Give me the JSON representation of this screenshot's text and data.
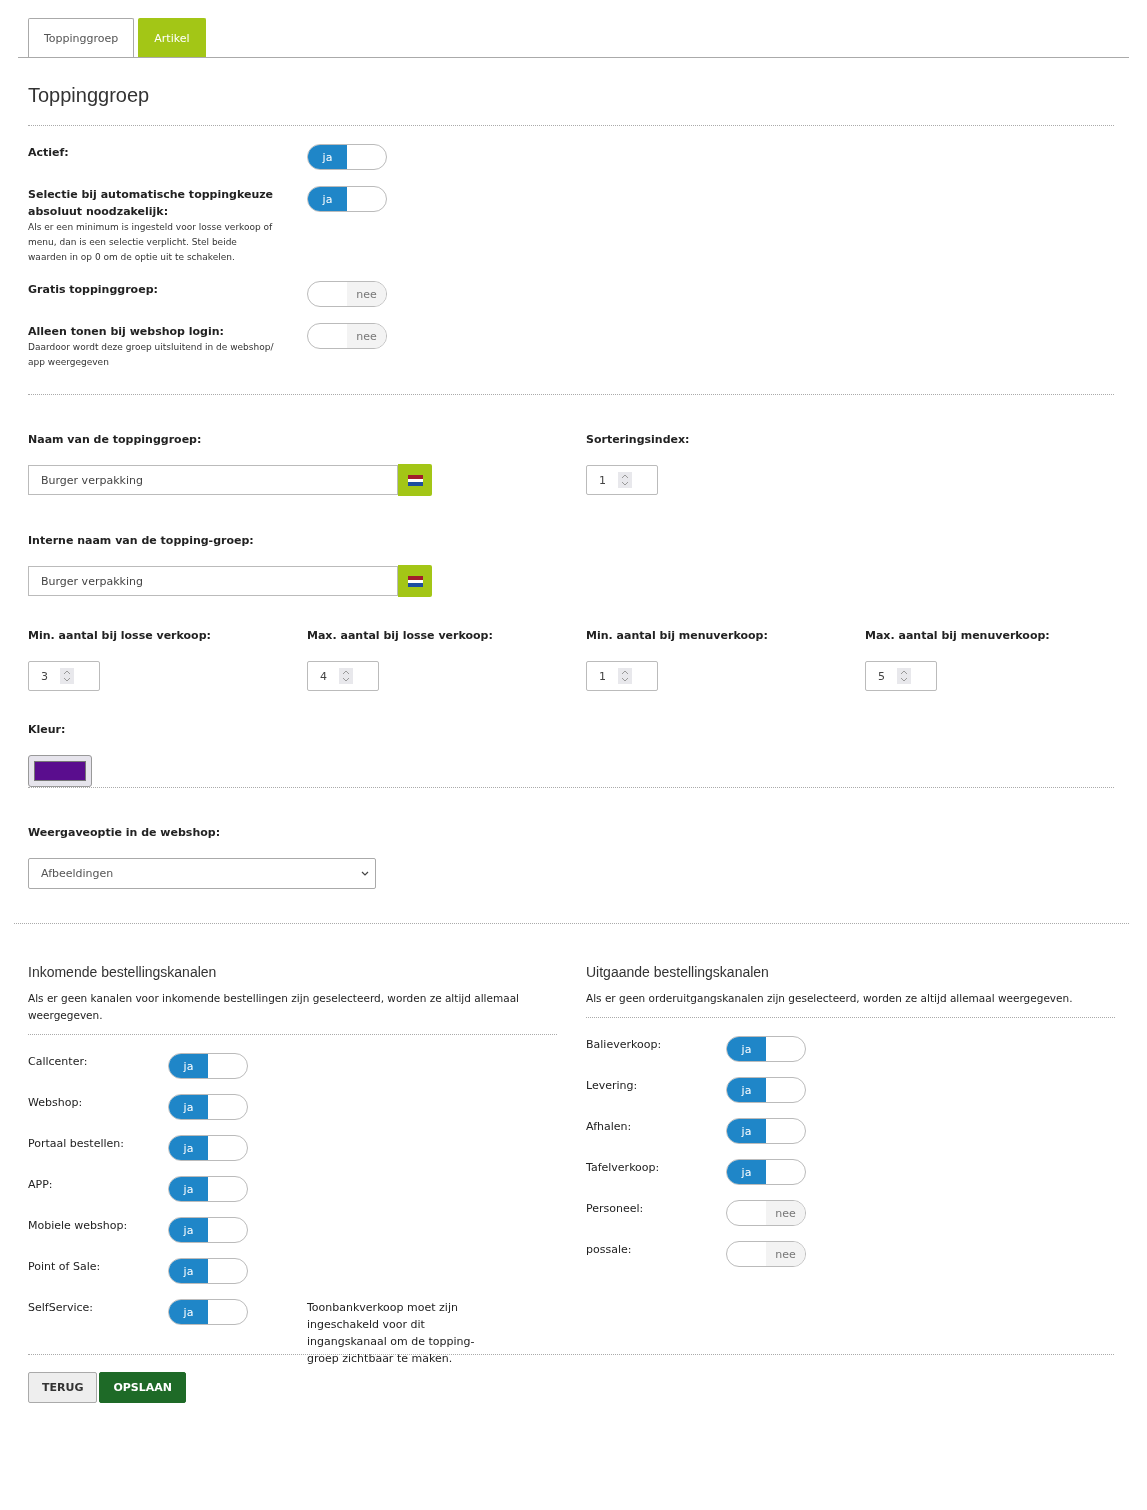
{
  "tabs": [
    {
      "label": "Toppinggroep",
      "selected": true
    },
    {
      "label": "Artikel",
      "selected": false
    }
  ],
  "heading": "Toppinggroep",
  "settings": [
    {
      "label": "Actief:",
      "toggle": {
        "on": true,
        "text": "ja"
      }
    },
    {
      "label": "Selectie bij automatische toppingkeuze absoluut noodzakelijk:",
      "description": "Als er een minimum is ingesteld voor losse verkoop of menu, dan is een selectie verplicht. Stel beide waarden in op 0 om de optie uit te schakelen.",
      "toggle": {
        "on": true,
        "text": "ja"
      }
    },
    {
      "label": "Gratis toppinggroep:",
      "toggle": {
        "on": false,
        "text": "nee"
      }
    },
    {
      "label": "Alleen tonen bij webshop login:",
      "description": "Daardoor wordt deze groep uitsluitend in de webshop/ app weergegeven",
      "toggle": {
        "on": false,
        "text": "nee"
      }
    }
  ],
  "name_field": {
    "label": "Naam van de toppinggroep:",
    "value": "Burger verpakking"
  },
  "sort_index": {
    "label": "Sorteringsindex:",
    "value": "1"
  },
  "internal_name_field": {
    "label": "Interne naam van de topping-groep:",
    "value": "Burger verpakking"
  },
  "quantities": [
    {
      "label": "Min. aantal bij losse verkoop:",
      "value": "3"
    },
    {
      "label": "Max. aantal bij losse verkoop:",
      "value": "4"
    },
    {
      "label": "Min. aantal bij menuverkoop:",
      "value": "1"
    },
    {
      "label": "Max. aantal bij menuverkoop:",
      "value": "5"
    }
  ],
  "color_field": {
    "label": "Kleur:",
    "color": "#5a0d8e"
  },
  "display_option": {
    "label": "Weergaveoptie in de webshop:",
    "value": "Afbeeldingen"
  },
  "incoming": {
    "title": "Inkomende bestellingskanalen",
    "description": "Als er geen kanalen voor inkomende bestellingen zijn geselecteerd, worden ze altijd allemaal weergegeven.",
    "channels": [
      {
        "label": "Callcenter:",
        "toggle": {
          "on": true,
          "text": "ja"
        }
      },
      {
        "label": "Webshop:",
        "toggle": {
          "on": true,
          "text": "ja"
        }
      },
      {
        "label": "Portaal bestellen:",
        "toggle": {
          "on": true,
          "text": "ja"
        }
      },
      {
        "label": "APP:",
        "toggle": {
          "on": true,
          "text": "ja"
        }
      },
      {
        "label": "Mobiele webshop:",
        "toggle": {
          "on": true,
          "text": "ja"
        }
      },
      {
        "label": "Point of Sale:",
        "toggle": {
          "on": true,
          "text": "ja"
        }
      },
      {
        "label": "SelfService:",
        "toggle": {
          "on": true,
          "text": "ja"
        },
        "note": "Toonbankverkoop moet zijn ingeschakeld voor dit ingangskanaal om de topping-groep zichtbaar te maken."
      }
    ]
  },
  "outgoing": {
    "title": "Uitgaande bestellingskanalen",
    "description": "Als er geen orderuitgangskanalen zijn geselecteerd, worden ze altijd allemaal weergegeven.",
    "channels": [
      {
        "label": "Balieverkoop:",
        "toggle": {
          "on": true,
          "text": "ja"
        }
      },
      {
        "label": "Levering:",
        "toggle": {
          "on": true,
          "text": "ja"
        }
      },
      {
        "label": "Afhalen:",
        "toggle": {
          "on": true,
          "text": "ja"
        }
      },
      {
        "label": "Tafelverkoop:",
        "toggle": {
          "on": true,
          "text": "ja"
        }
      },
      {
        "label": "Personeel:",
        "toggle": {
          "on": false,
          "text": "nee"
        }
      },
      {
        "label": "possale:",
        "toggle": {
          "on": false,
          "text": "nee"
        }
      }
    ]
  },
  "buttons": [
    {
      "label": "TERUG",
      "kind": "secondary"
    },
    {
      "label": "OPSLAAN",
      "kind": "primary"
    }
  ]
}
